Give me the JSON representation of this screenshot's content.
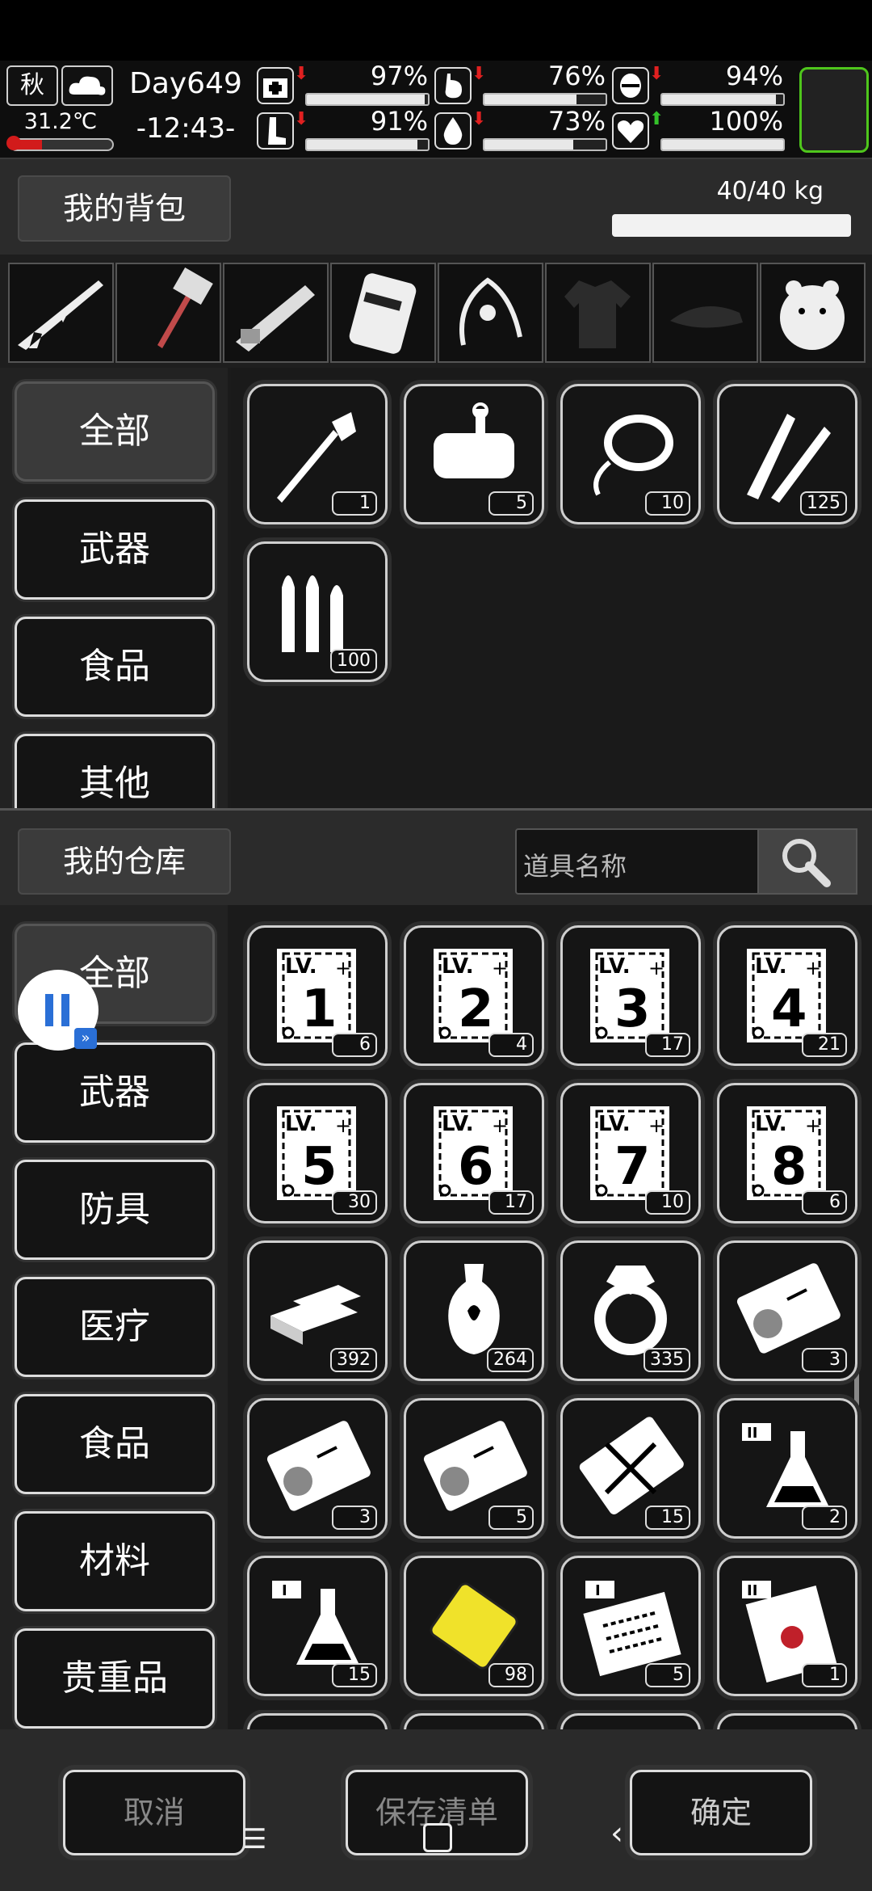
{
  "hud": {
    "season": "秋",
    "temperature": "31.2℃",
    "temperature_level": 0.3,
    "day": "Day649",
    "time": "-12:43-",
    "stats": [
      {
        "icon": "medkit-icon",
        "value": "97%",
        "fill": 0.97,
        "arrow": "down",
        "arrow_color": "#e02020"
      },
      {
        "icon": "stomach-icon",
        "value": "76%",
        "fill": 0.76,
        "arrow": "down",
        "arrow_color": "#e02020"
      },
      {
        "icon": "mouth-icon",
        "value": "94%",
        "fill": 0.94,
        "arrow": "down",
        "arrow_color": "#e02020"
      },
      {
        "icon": "leg-icon",
        "value": "91%",
        "fill": 0.91,
        "arrow": "down",
        "arrow_color": "#e02020"
      },
      {
        "icon": "water-drop-icon",
        "value": "73%",
        "fill": 0.73,
        "arrow": "down",
        "arrow_color": "#e02020"
      },
      {
        "icon": "heart-icon",
        "value": "100%",
        "fill": 1.0,
        "arrow": "up",
        "arrow_color": "#34c02a"
      }
    ],
    "accent": "#4fc61c"
  },
  "backpack": {
    "title": "我的背包",
    "weight": "40/40 kg",
    "weight_level": 1.0,
    "equipment": [
      "sniper-rifle-icon",
      "hammer-icon",
      "minigun-icon",
      "backpack-gear-icon",
      "vine-bow-icon",
      "shirt-icon",
      "cap-icon",
      "hamster-bag-icon"
    ],
    "categories": [
      "全部",
      "武器",
      "食品",
      "其他"
    ],
    "items": [
      {
        "icon": "shovel-icon",
        "count": "1"
      },
      {
        "icon": "canned-food-icon",
        "count": "5"
      },
      {
        "icon": "rope-icon",
        "count": "10"
      },
      {
        "icon": "rifle-ammo-icon",
        "count": "125"
      },
      {
        "icon": "bullets-icon",
        "count": "100"
      }
    ]
  },
  "warehouse": {
    "title": "我的仓库",
    "search_placeholder": "道具名称",
    "categories": [
      "全部",
      "武器",
      "防具",
      "医疗",
      "食品",
      "材料",
      "贵重品"
    ],
    "items": [
      {
        "icon": "level-ticket-icon",
        "level": "1",
        "lv_label": "LV.",
        "count": "6"
      },
      {
        "icon": "level-ticket-icon",
        "level": "2",
        "lv_label": "LV.",
        "count": "4"
      },
      {
        "icon": "level-ticket-icon",
        "level": "3",
        "lv_label": "LV.",
        "count": "17"
      },
      {
        "icon": "level-ticket-icon",
        "level": "4",
        "lv_label": "LV.",
        "count": "21"
      },
      {
        "icon": "level-ticket-icon",
        "level": "5",
        "lv_label": "LV.",
        "count": "30"
      },
      {
        "icon": "level-ticket-icon",
        "level": "6",
        "lv_label": "LV.",
        "count": "17"
      },
      {
        "icon": "level-ticket-icon",
        "level": "7",
        "lv_label": "LV.",
        "count": "10"
      },
      {
        "icon": "level-ticket-icon",
        "level": "8",
        "lv_label": "LV.",
        "count": "6"
      },
      {
        "icon": "gold-bars-icon",
        "count": "392"
      },
      {
        "icon": "vase-icon",
        "count": "264"
      },
      {
        "icon": "ring-icon",
        "count": "335"
      },
      {
        "icon": "recruit-card-icon",
        "count": "3"
      },
      {
        "icon": "recruit-card-icon",
        "count": "3"
      },
      {
        "icon": "recruit-card-icon",
        "count": "5"
      },
      {
        "icon": "crossed-ticket-icon",
        "count": "15"
      },
      {
        "icon": "flask-ii-icon",
        "count": "2"
      },
      {
        "icon": "flask-i-icon",
        "count": "15"
      },
      {
        "icon": "yellow-plate-icon",
        "count": "98"
      },
      {
        "icon": "blueprint-i-icon",
        "count": "5"
      },
      {
        "icon": "blueprint-ii-icon",
        "count": "1"
      }
    ]
  },
  "footer": {
    "cancel": "取消",
    "save_list": "保存清单",
    "confirm": "确定"
  }
}
